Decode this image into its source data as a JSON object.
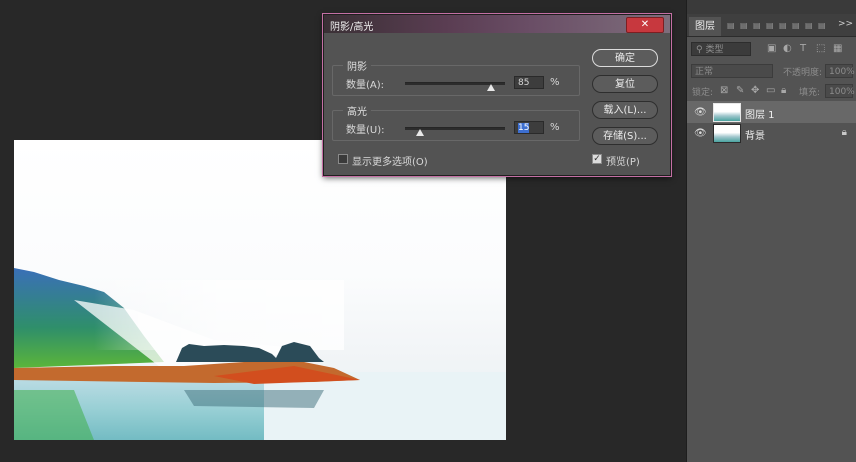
{
  "dialog": {
    "title": "阴影/高光",
    "close_glyph": "✕",
    "shadows": {
      "legend": "阴影",
      "amount_label": "数量(A):",
      "amount_value": "85",
      "unit": "%"
    },
    "highlights": {
      "legend": "高光",
      "amount_label": "数量(U):",
      "amount_value": "15",
      "unit": "%"
    },
    "buttons": {
      "ok": "确定",
      "reset": "复位",
      "load": "载入(L)...",
      "save": "存储(S)..."
    },
    "more_options_label": "显示更多选项(O)",
    "more_options_checked": false,
    "preview_label": "预览(P)",
    "preview_checked": true
  },
  "layers_panel": {
    "tab_label": "图层",
    "collapse_glyph": ">>",
    "filter_placeholder": "类型",
    "blend_mode": "正常",
    "opacity_label": "不透明度:",
    "opacity_value": "100%",
    "lock_label": "锁定:",
    "fill_label": "填充:",
    "fill_value": "100%",
    "layers": [
      {
        "name": "图层 1",
        "selected": true,
        "locked": false
      },
      {
        "name": "背景",
        "selected": false,
        "locked": true
      }
    ]
  }
}
